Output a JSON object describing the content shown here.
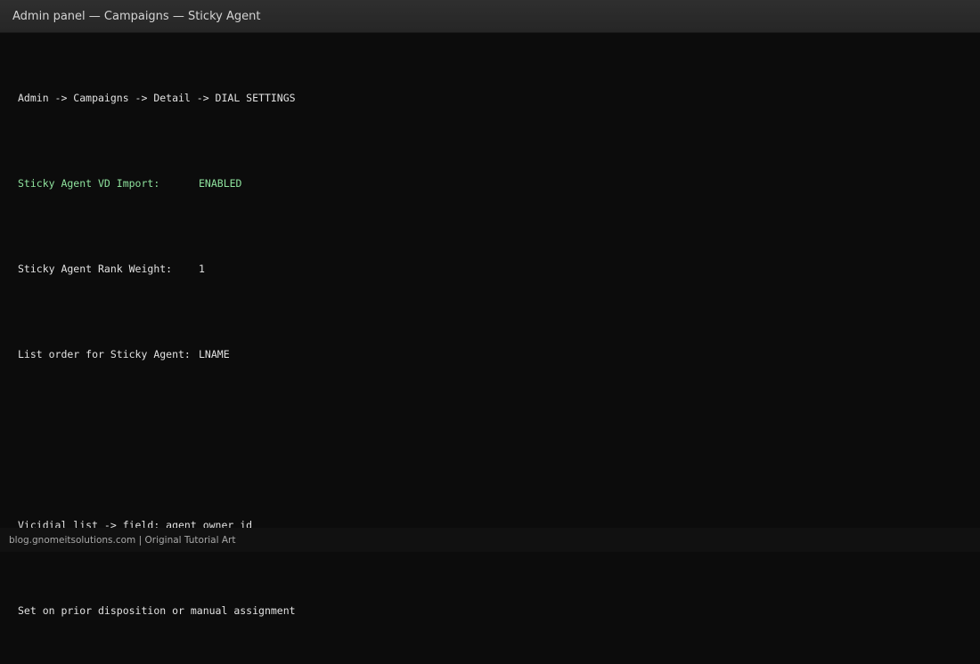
{
  "window": {
    "title": "Admin panel — Campaigns — Sticky Agent"
  },
  "terminal": {
    "breadcrumb": "Admin -> Campaigns -> Detail -> DIAL SETTINGS",
    "settings": [
      {
        "label": "Sticky Agent VD Import:",
        "value": "ENABLED"
      },
      {
        "label": "Sticky Agent Rank Weight:",
        "value": "1"
      },
      {
        "label": "List order for Sticky Agent:",
        "value": "LNAME"
      }
    ],
    "field_line": "Vicidial_list -> field: agent_owner_id",
    "note_line": "Set on prior disposition or manual assignment"
  },
  "footer": {
    "credit": "blog.gnomeitsolutions.com | Original Tutorial Art"
  },
  "colors": {
    "background": "#0c0c0c",
    "highlight": "#8fe39e",
    "text": "#e2e2e2"
  }
}
